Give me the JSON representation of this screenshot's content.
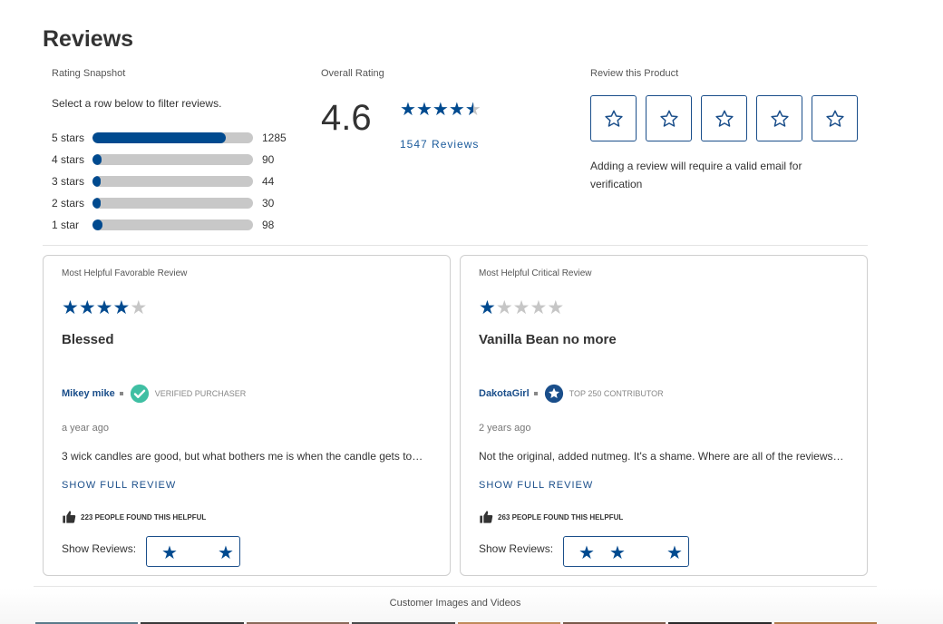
{
  "page": {
    "title": "Reviews"
  },
  "snapshot": {
    "label": "Rating Snapshot",
    "instruction": "Select a row below to filter reviews.",
    "rows": [
      {
        "label": "5 stars",
        "count": "1285",
        "fraction": 0.831
      },
      {
        "label": "4 stars",
        "count": "90",
        "fraction": 0.058
      },
      {
        "label": "3 stars",
        "count": "44",
        "fraction": 0.028
      },
      {
        "label": "2 stars",
        "count": "30",
        "fraction": 0.019
      },
      {
        "label": "1 star",
        "count": "98",
        "fraction": 0.063
      }
    ]
  },
  "overall": {
    "label": "Overall Rating",
    "value": "4.6",
    "stars_fill": 4.6,
    "review_count": "1547 Reviews"
  },
  "write": {
    "label": "Review this Product",
    "note": "Adding a review will require a valid email for verification",
    "star_count": 5
  },
  "favorable": {
    "header": "Most Helpful Favorable Review",
    "rating": 4,
    "title": "Blessed",
    "author": "Mikey mike",
    "badge": "VERIFIED PURCHASER",
    "date": "a year ago",
    "body": "3 wick candles are good, but what bothers me is when the candle gets to…",
    "show_full": "SHOW FULL REVIEW",
    "helpful": "223 PEOPLE FOUND THIS HELPFUL",
    "show_reviews_label": "Show Reviews:"
  },
  "critical": {
    "header": "Most Helpful Critical Review",
    "rating": 1,
    "title": "Vanilla Bean no more",
    "author": "DakotaGirl",
    "badge": "TOP 250 CONTRIBUTOR",
    "date": "2 years ago",
    "body": "Not the original, added nutmeg. It's a shame. Where are all of the reviews…",
    "show_full": "SHOW FULL REVIEW",
    "helpful": "263 PEOPLE FOUND THIS HELPFUL",
    "show_reviews_label": "Show Reviews:"
  },
  "media": {
    "label": "Customer Images and Videos"
  },
  "colors": {
    "accent": "#004a8f",
    "link": "#1a4e8a",
    "verified": "#3fbfa3",
    "track": "#c8c8c8"
  }
}
